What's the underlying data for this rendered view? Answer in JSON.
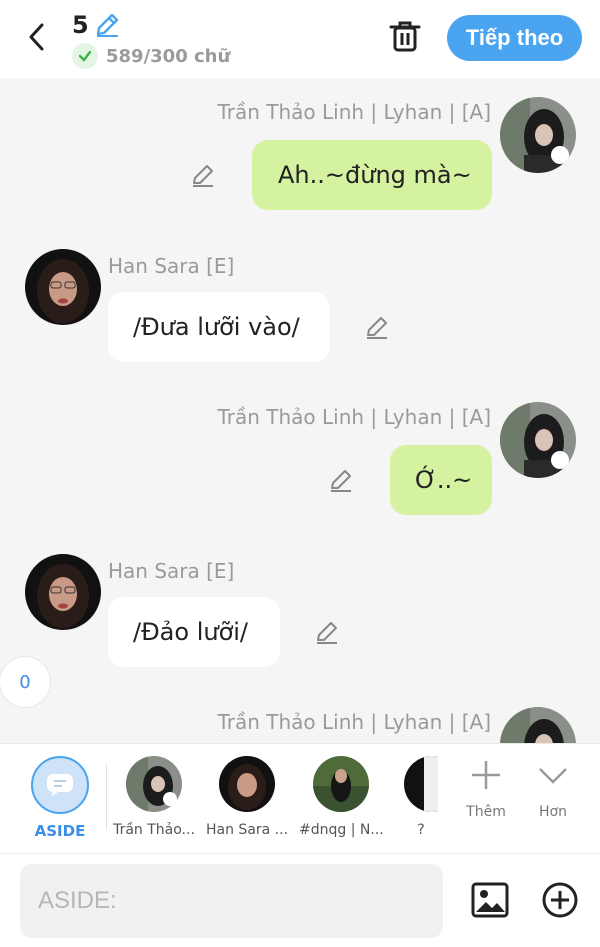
{
  "header": {
    "title_number": "5",
    "word_count": "589/300 chữ",
    "next_label": "Tiếp theo"
  },
  "messages": [
    {
      "sender": "Trần Thảo Linh | Lyhan | [A]",
      "text": "Ah..~đừng mà~",
      "side": "right"
    },
    {
      "sender": "Han Sara [E]",
      "text": "/Đưa lưỡi vào/",
      "side": "left"
    },
    {
      "sender": "Trần Thảo Linh | Lyhan | [A]",
      "text": "Ớ..~",
      "side": "right"
    },
    {
      "sender": "Han Sara [E]",
      "text": "/Đảo lưỡi/",
      "side": "left"
    },
    {
      "sender": "Trần Thảo Linh | Lyhan | [A]",
      "text": "",
      "side": "right"
    }
  ],
  "side_counter": "0",
  "characters": [
    {
      "label": "ASIDE"
    },
    {
      "label": "Trần Thảo..."
    },
    {
      "label": "Han Sara ..."
    },
    {
      "label": "#dnqg | N..."
    },
    {
      "label": "? "
    }
  ],
  "tools": {
    "add_label": "Thêm",
    "more_label": "Hơn"
  },
  "input": {
    "placeholder": "ASIDE:"
  },
  "colors": {
    "accent": "#4aa4ef",
    "bubble_right": "#d5f2a0",
    "bubble_left": "#ffffff",
    "background": "#f5f5f5"
  }
}
